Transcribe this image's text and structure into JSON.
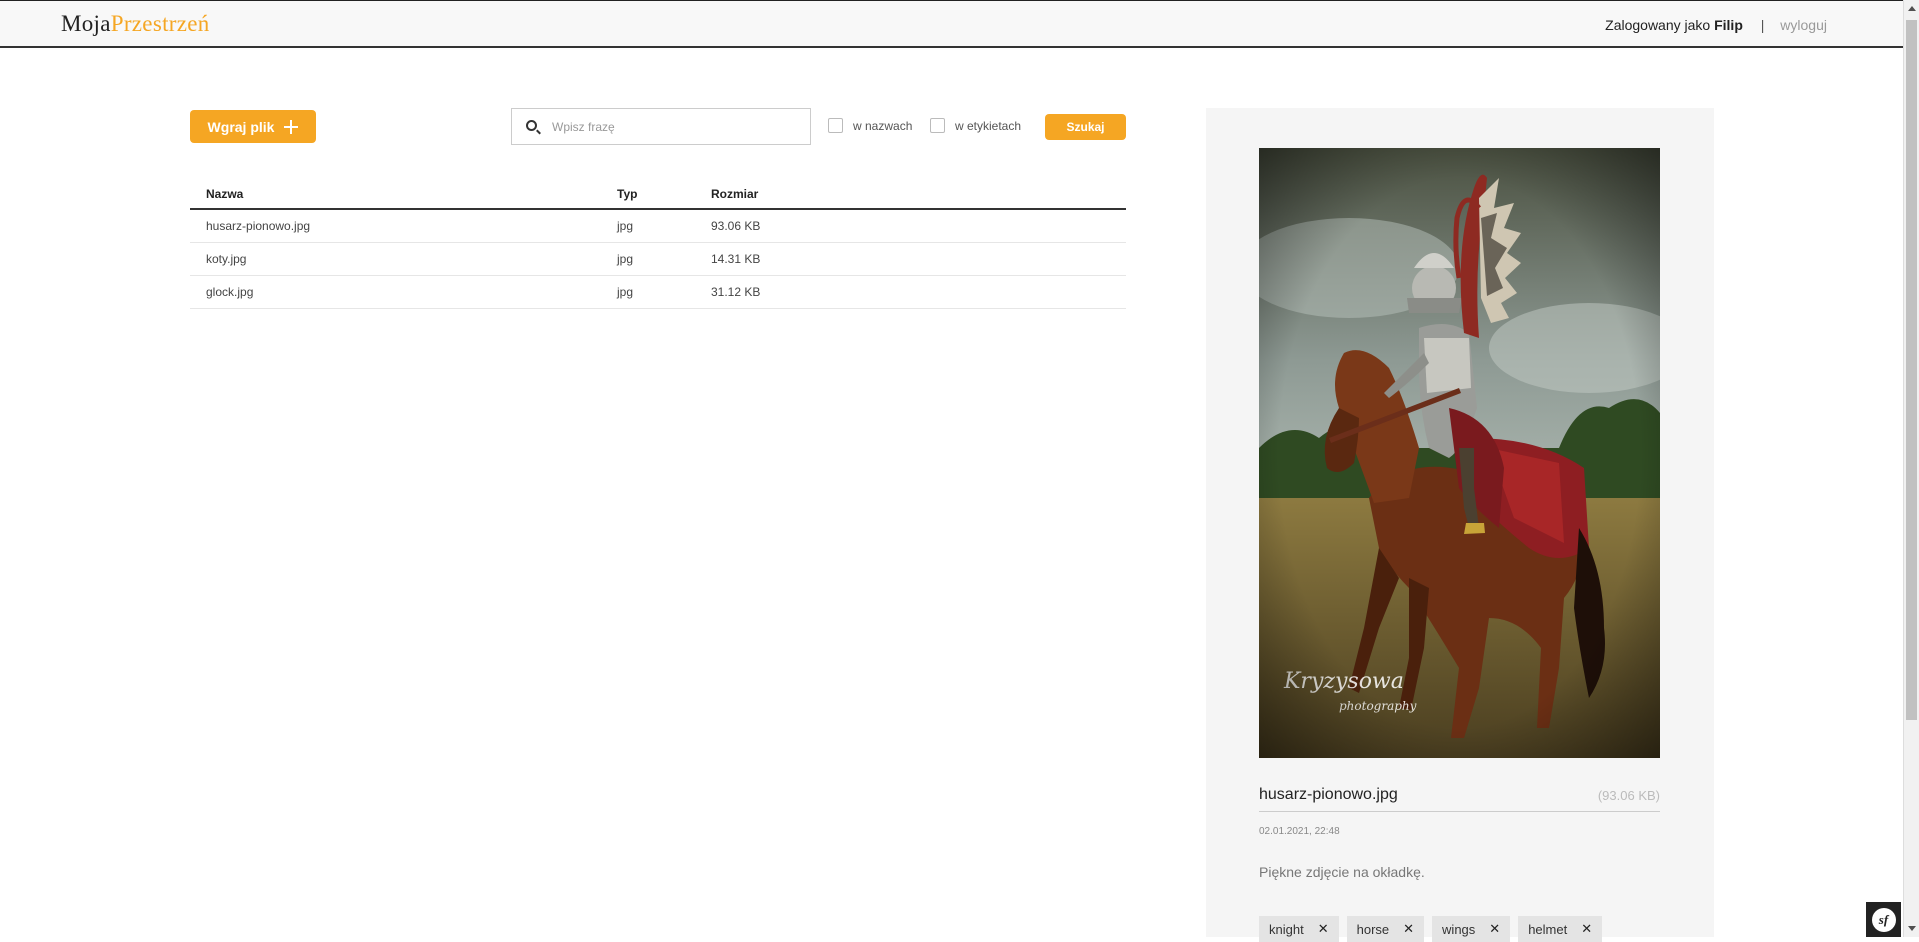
{
  "header": {
    "logo_part1": "Moja",
    "logo_part2": "Przestrzeń",
    "logged_in_prefix": "Zalogowany jako",
    "username": "Filip",
    "separator": "|",
    "logout_label": "wyloguj"
  },
  "toolbar": {
    "upload_label": "Wgraj plik",
    "search_placeholder": "Wpisz frazę",
    "search_value": "",
    "filter_names_label": "w nazwach",
    "filter_tags_label": "w etykietach",
    "search_button_label": "Szukaj"
  },
  "table": {
    "headers": {
      "name": "Nazwa",
      "type": "Typ",
      "size": "Rozmiar"
    },
    "rows": [
      {
        "name": "husarz-pionowo.jpg",
        "type": "jpg",
        "size": "93.06 KB"
      },
      {
        "name": "koty.jpg",
        "type": "jpg",
        "size": "14.31 KB"
      },
      {
        "name": "glock.jpg",
        "type": "jpg",
        "size": "31.12 KB"
      }
    ]
  },
  "preview": {
    "file_name": "husarz-pionowo.jpg",
    "file_size": "(93.06 KB)",
    "date": "02.01.2021, 22:48",
    "description": "Piękne zdjęcie na okładkę.",
    "tags": [
      "knight",
      "horse",
      "wings",
      "helmet"
    ],
    "image_watermark": "Kryzysowa photography"
  },
  "symfony_badge": "sf",
  "colors": {
    "accent": "#f5a623",
    "header_bg": "#f8f8f8",
    "panel_bg": "#f5f5f5"
  }
}
